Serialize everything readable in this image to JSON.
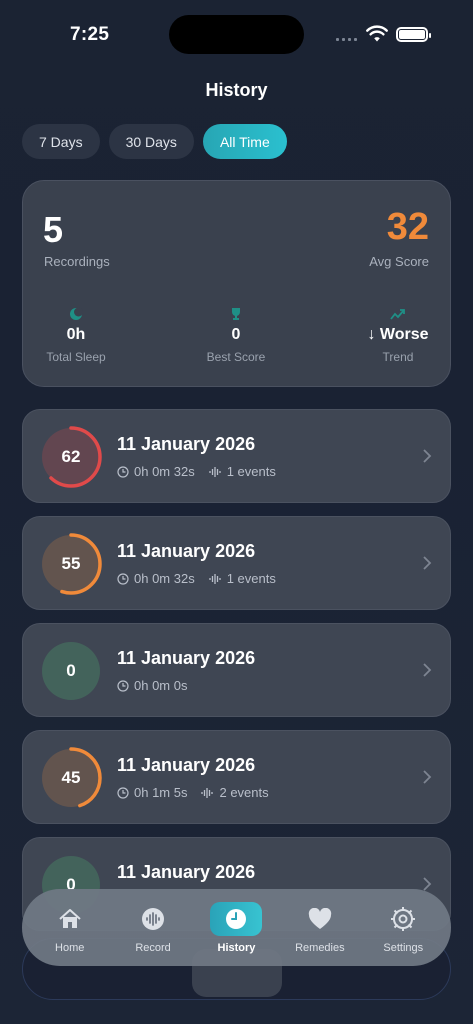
{
  "status_bar": {
    "time": "7:25"
  },
  "page_title": "History",
  "filters": [
    {
      "label": "7 Days",
      "active": false
    },
    {
      "label": "30 Days",
      "active": false
    },
    {
      "label": "All Time",
      "active": true
    }
  ],
  "summary": {
    "recordings_value": "5",
    "recordings_label": "Recordings",
    "avg_score_value": "32",
    "avg_score_label": "Avg Score",
    "stats": [
      {
        "icon": "moon-icon",
        "value": "0h",
        "label": "Total Sleep"
      },
      {
        "icon": "trophy-icon",
        "value": "0",
        "label": "Best Score"
      },
      {
        "icon": "trend-chart-icon",
        "value": "↓ Worse",
        "label": "Trend"
      }
    ]
  },
  "sessions": [
    {
      "score": "62",
      "score_fraction": 0.62,
      "ring_color": "#e04a4a",
      "date": "11 January 2026",
      "duration": "0h 0m 32s",
      "events": "1 events"
    },
    {
      "score": "55",
      "score_fraction": 0.55,
      "ring_color": "#f08a3a",
      "date": "11 January 2026",
      "duration": "0h 0m 32s",
      "events": "1 events"
    },
    {
      "score": "0",
      "score_fraction": 0,
      "ring_color": "#4a9a6a",
      "date": "11 January 2026",
      "duration": "0h 0m 0s",
      "events": ""
    },
    {
      "score": "45",
      "score_fraction": 0.45,
      "ring_color": "#f08a3a",
      "date": "11 January 2026",
      "duration": "0h 1m 5s",
      "events": "2 events"
    },
    {
      "score": "0",
      "score_fraction": 0,
      "ring_color": "#4a9a6a",
      "date": "11 January 2026",
      "duration": "",
      "events": ""
    }
  ],
  "tab_bar": [
    {
      "label": "Home",
      "icon": "house-icon",
      "active": false
    },
    {
      "label": "Record",
      "icon": "waveform-icon",
      "active": false
    },
    {
      "label": "History",
      "icon": "clock-icon",
      "active": true
    },
    {
      "label": "Remedies",
      "icon": "heart-icon",
      "active": false
    },
    {
      "label": "Settings",
      "icon": "gear-icon",
      "active": false
    }
  ],
  "colors": {
    "accent": "#2ab0c0",
    "score_orange": "#f08a3a",
    "score_red": "#e04a4a",
    "score_green": "#4a9a6a"
  }
}
